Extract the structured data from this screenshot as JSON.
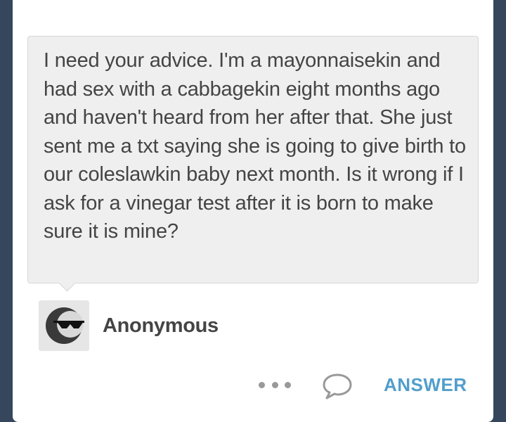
{
  "post": {
    "question": "I need your advice. I'm a mayonnaisekin and had  sex with a cabbagekin eight months ago and haven't heard from her after that. She just sent me a txt saying she is going to give birth to our coleslawkin baby next month. Is it wrong if I ask  for a vinegar test after it is born to make sure it is mine?",
    "asker_name": "Anonymous",
    "avatar_icon": "anonymous-sunglasses-icon"
  },
  "actions": {
    "more_icon": "more-dots-icon",
    "reply_icon": "speech-bubble-icon",
    "answer_label": "ANSWER"
  },
  "colors": {
    "background": "#36465d",
    "accent": "#529ecc",
    "bubble": "#efefef",
    "text": "#444444"
  }
}
